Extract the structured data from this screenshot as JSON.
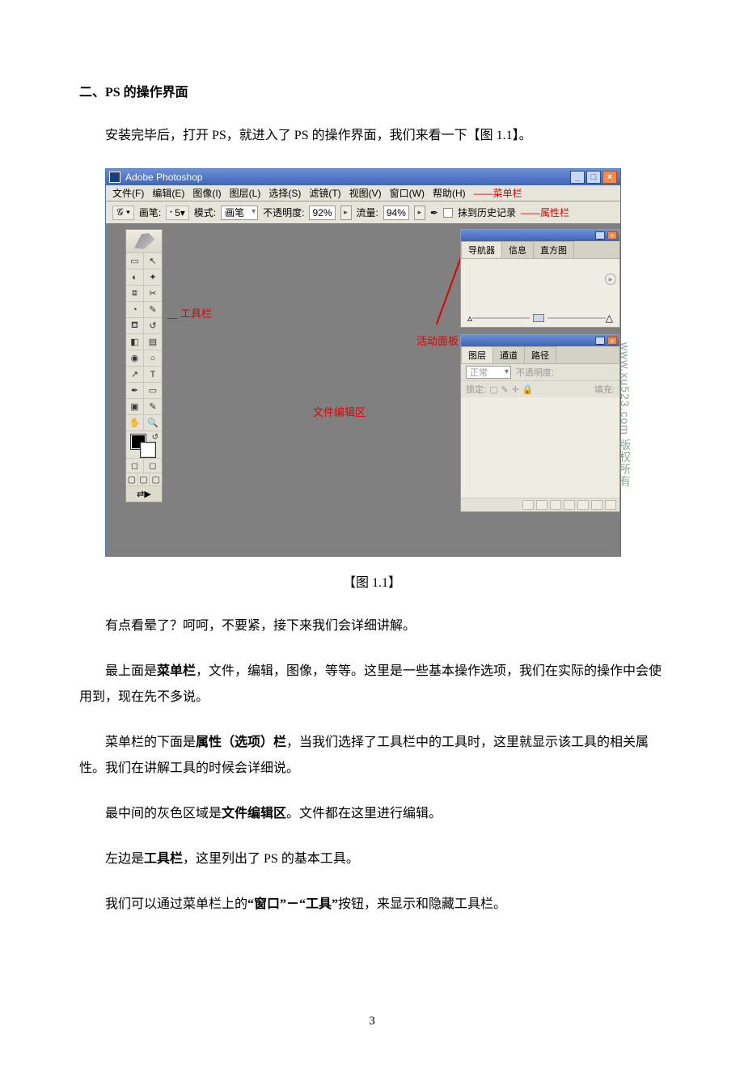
{
  "section_title": "二、PS 的操作界面",
  "intro": "安装完毕后，打开 PS，就进入了 PS 的操作界面，我们来看一下【图 1.1】。",
  "figure_caption": "【图 1.1】",
  "para_a": "有点看晕了？呵呵，不要紧，接下来我们会详细讲解。",
  "para_b1": "最上面是",
  "para_b_bold": "菜单栏",
  "para_b2": "，文件，编辑，图像，等等。这里是一些基本操作选项，我们在实际的操作中会使用到，现在先不多说。",
  "para_c1": "菜单栏的下面是",
  "para_c_bold": "属性（选项）栏",
  "para_c2": "，当我们选择了工具栏中的工具时，这里就显示该工具的相关属性。我们在讲解工具的时候会详细说。",
  "para_d1": "最中间的灰色区域是",
  "para_d_bold": "文件编辑区",
  "para_d2": "。文件都在这里进行编辑。",
  "para_e1": "左边是",
  "para_e_bold": "工具栏",
  "para_e2": "，这里列出了 PS 的基本工具。",
  "para_f1": "我们可以通过菜单栏上的",
  "para_f_bold": "“窗口”－“工具”",
  "para_f2": "按钮，来显示和隐藏工具栏。",
  "page_number": "3",
  "ps": {
    "title": "Adobe Photoshop",
    "menu": {
      "file": "文件(F)",
      "edit": "编辑(E)",
      "image": "图像(I)",
      "layer": "图层(L)",
      "select": "选择(S)",
      "filter": "滤镜(T)",
      "view": "视图(V)",
      "window": "窗口(W)",
      "help": "帮助(H)",
      "anno_label": "——菜单栏"
    },
    "options": {
      "brush_label": "画笔:",
      "brush_size": "5",
      "mode_label": "模式:",
      "mode_value": "画笔",
      "opacity_label": "不透明度:",
      "opacity_value": "92%",
      "flow_label": "流量:",
      "flow_value": "94%",
      "history_label": "抹到历史记录",
      "anno_label": "——属性栏"
    },
    "annotations": {
      "toolbar": "工具栏",
      "edit_area": "文件编辑区",
      "panels": "活动面板"
    },
    "panel_nav": {
      "tab1": "导航器",
      "tab2": "信息",
      "tab3": "直方图"
    },
    "panel_layers": {
      "tab1": "图层",
      "tab2": "通道",
      "tab3": "路径",
      "blend": "正常",
      "opacity_label": "不透明度:",
      "lock_label": "锁定:",
      "fill_label": "填充:"
    },
    "watermark": "www.xu523.com 版权所有"
  }
}
